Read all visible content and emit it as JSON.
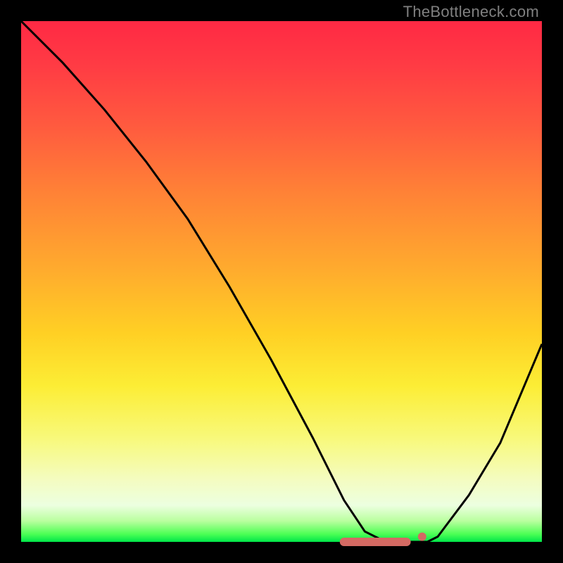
{
  "watermark": "TheBottleneck.com",
  "chart_data": {
    "type": "line",
    "title": "",
    "xlabel": "",
    "ylabel": "",
    "xlim": [
      0,
      100
    ],
    "ylim": [
      0,
      100
    ],
    "grid": false,
    "series": [
      {
        "name": "bottleneck-curve",
        "x": [
          0,
          8,
          16,
          24,
          32,
          40,
          48,
          56,
          62,
          66,
          70,
          74,
          78,
          80,
          86,
          92,
          100
        ],
        "y": [
          100,
          92,
          83,
          73,
          62,
          49,
          35,
          20,
          8,
          2,
          0,
          0,
          0,
          1,
          9,
          19,
          38
        ]
      }
    ],
    "markers": [
      {
        "name": "flat-bottom-segment",
        "x_start": 62,
        "x_end": 74,
        "y": 0,
        "color": "#d46a63"
      },
      {
        "name": "marker-dot",
        "x": 77,
        "y": 1,
        "color": "#d46a63"
      }
    ]
  }
}
